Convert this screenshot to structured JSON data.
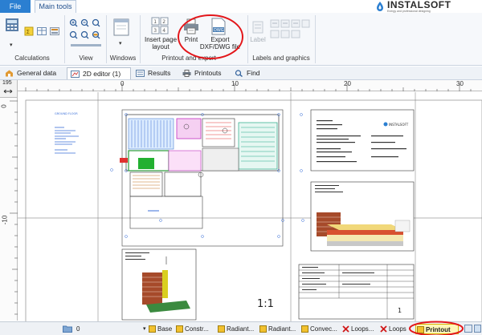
{
  "menu": {
    "file": "File",
    "main_tools": "Main tools"
  },
  "brand": {
    "name": "INSTALSOFT",
    "tagline": "Energy and professional designing"
  },
  "ribbon": {
    "groups": {
      "calculations": "Calculations",
      "view": "View",
      "windows": "Windows",
      "printout_export": "Printout and export",
      "labels_graphics": "Labels and graphics"
    },
    "buttons": {
      "insert_page_layout": [
        "Insert page",
        "layout"
      ],
      "print": "Print",
      "export": [
        "Export",
        "DXF/DWG file"
      ],
      "label": "Label",
      "dwg_icon_text": "DWG"
    }
  },
  "doc_tabs": [
    {
      "label": "General data",
      "icon": "general-data-icon"
    },
    {
      "label": "2D editor (1)",
      "icon": "editor-icon",
      "active": true
    },
    {
      "label": "Results",
      "icon": "results-icon"
    },
    {
      "label": "Printouts",
      "icon": "printer-icon"
    },
    {
      "label": "Find",
      "icon": "search-icon"
    }
  ],
  "rulers": {
    "top": [
      "0",
      "10",
      "20",
      "30"
    ],
    "left": [
      "0",
      "-10"
    ],
    "corner_value": "195"
  },
  "drawing": {
    "scale": "1:1",
    "sheet_number": "1",
    "legend_title": "GROUND FLOOR",
    "company": "INSTALSOFT"
  },
  "status": {
    "count": "0",
    "tabs": [
      {
        "label": "Base"
      },
      {
        "label": "Constr..."
      },
      {
        "label": "Radiant..."
      },
      {
        "label": "Radiant..."
      },
      {
        "label": "Convec..."
      },
      {
        "label": "Loops..."
      },
      {
        "label": "Loops"
      },
      {
        "label": "Printout",
        "active": true
      }
    ]
  },
  "colors": {
    "accent": "#2b7fd1",
    "highlight_circle": "#e3161a",
    "status_active": "#fff7b8"
  }
}
